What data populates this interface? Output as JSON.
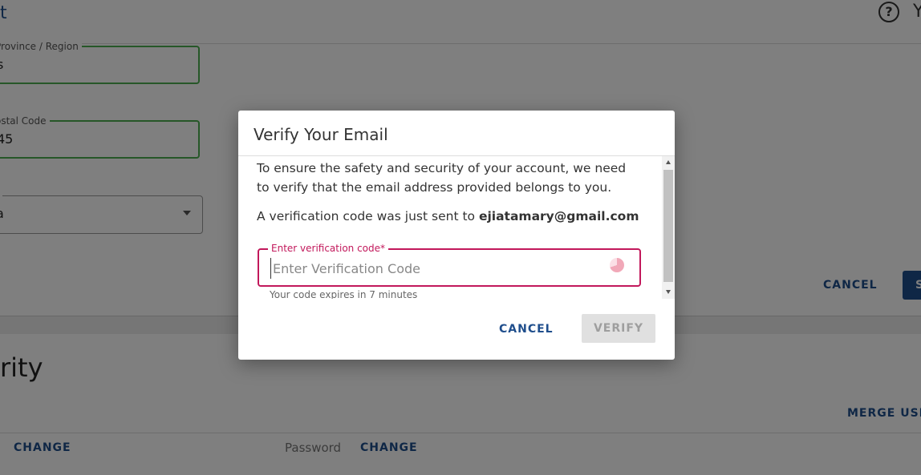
{
  "background": {
    "header": {
      "title_fragment": "t",
      "help_icon": "?",
      "user_icon_fragment": "Y"
    },
    "form": {
      "province": {
        "label": "Province / Region",
        "value": "s"
      },
      "postal": {
        "label": "ostal Code",
        "value": "45"
      },
      "country": {
        "label": "*",
        "value": "a"
      },
      "cancel_label": "CANCEL",
      "save_label": "S"
    },
    "security": {
      "heading": "rity",
      "merge_label": "MERGE USER",
      "change_label_1": "CHANGE",
      "password_label": "Password",
      "change_label_2": "CHANGE"
    }
  },
  "dialog": {
    "title": "Verify Your Email",
    "intro": "To ensure the safety and security of your account, we need to verify that the email address provided belongs to you.",
    "sent_prefix": "A verification code was just sent to ",
    "email": "ejiatamary@gmail.com",
    "code_field": {
      "label": "Enter verification code*",
      "placeholder": "Enter Verification Code",
      "value": ""
    },
    "helper": "Your code expires in 7 minutes",
    "cancel_label": "CANCEL",
    "verify_label": "VERIFY"
  }
}
